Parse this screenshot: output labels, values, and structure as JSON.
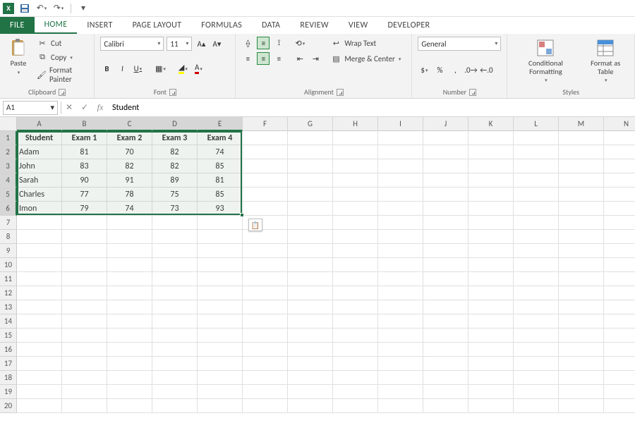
{
  "qat": {
    "save_tip": "Save",
    "undo_tip": "Undo",
    "redo_tip": "Redo"
  },
  "tabs": {
    "file": "FILE",
    "home": "HOME",
    "insert": "INSERT",
    "page_layout": "PAGE LAYOUT",
    "formulas": "FORMULAS",
    "data": "DATA",
    "review": "REVIEW",
    "view": "VIEW",
    "developer": "DEVELOPER"
  },
  "ribbon": {
    "clipboard": {
      "paste": "Paste",
      "cut": "Cut",
      "copy": "Copy",
      "format_painter": "Format Painter",
      "label": "Clipboard"
    },
    "font": {
      "name": "Calibri",
      "size": "11",
      "bold": "B",
      "italic": "I",
      "underline": "U",
      "label": "Font"
    },
    "alignment": {
      "wrap": "Wrap Text",
      "merge": "Merge & Center",
      "label": "Alignment"
    },
    "number": {
      "format": "General",
      "label": "Number"
    },
    "styles": {
      "cond": "Conditional\nFormatting",
      "table": "Format as\nTable",
      "label": "Styles"
    }
  },
  "name_box": "A1",
  "formula_bar": "Student",
  "columns": [
    "A",
    "B",
    "C",
    "D",
    "E",
    "F",
    "G",
    "H",
    "I",
    "J",
    "K",
    "L",
    "M",
    "N"
  ],
  "selected_cols": [
    "A",
    "B",
    "C",
    "D",
    "E"
  ],
  "selected_rows": [
    1,
    2,
    3,
    4,
    5,
    6
  ],
  "sheet": {
    "headers": [
      "Student",
      "Exam 1",
      "Exam 2",
      "Exam 3",
      "Exam 4"
    ],
    "rows": [
      {
        "name": "Adam",
        "v": [
          81,
          70,
          82,
          74
        ]
      },
      {
        "name": "John",
        "v": [
          83,
          82,
          82,
          85
        ]
      },
      {
        "name": "Sarah",
        "v": [
          90,
          91,
          89,
          81
        ]
      },
      {
        "name": "Charles",
        "v": [
          77,
          78,
          75,
          85
        ]
      },
      {
        "name": "Imon",
        "v": [
          79,
          74,
          73,
          93
        ]
      }
    ]
  },
  "chart_data": {
    "type": "table",
    "title": "",
    "columns": [
      "Student",
      "Exam 1",
      "Exam 2",
      "Exam 3",
      "Exam 4"
    ],
    "rows": [
      [
        "Adam",
        81,
        70,
        82,
        74
      ],
      [
        "John",
        83,
        82,
        82,
        85
      ],
      [
        "Sarah",
        90,
        91,
        89,
        81
      ],
      [
        "Charles",
        77,
        78,
        75,
        85
      ],
      [
        "Imon",
        79,
        74,
        73,
        93
      ]
    ]
  }
}
